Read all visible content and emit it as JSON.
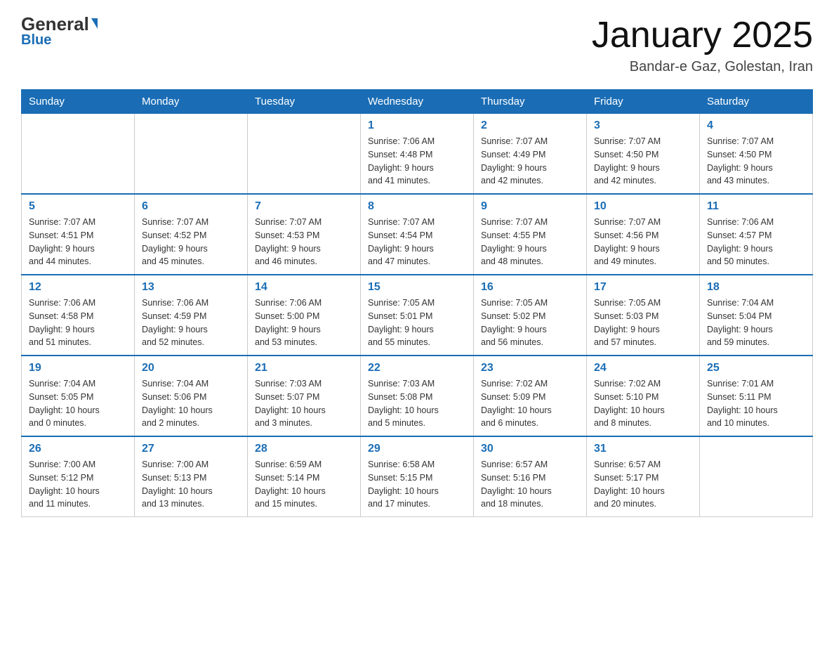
{
  "header": {
    "logo_top": "General",
    "logo_bottom": "Blue",
    "title": "January 2025",
    "subtitle": "Bandar-e Gaz, Golestan, Iran"
  },
  "days_of_week": [
    "Sunday",
    "Monday",
    "Tuesday",
    "Wednesday",
    "Thursday",
    "Friday",
    "Saturday"
  ],
  "weeks": [
    [
      {
        "day": "",
        "info": ""
      },
      {
        "day": "",
        "info": ""
      },
      {
        "day": "",
        "info": ""
      },
      {
        "day": "1",
        "info": "Sunrise: 7:06 AM\nSunset: 4:48 PM\nDaylight: 9 hours\nand 41 minutes."
      },
      {
        "day": "2",
        "info": "Sunrise: 7:07 AM\nSunset: 4:49 PM\nDaylight: 9 hours\nand 42 minutes."
      },
      {
        "day": "3",
        "info": "Sunrise: 7:07 AM\nSunset: 4:50 PM\nDaylight: 9 hours\nand 42 minutes."
      },
      {
        "day": "4",
        "info": "Sunrise: 7:07 AM\nSunset: 4:50 PM\nDaylight: 9 hours\nand 43 minutes."
      }
    ],
    [
      {
        "day": "5",
        "info": "Sunrise: 7:07 AM\nSunset: 4:51 PM\nDaylight: 9 hours\nand 44 minutes."
      },
      {
        "day": "6",
        "info": "Sunrise: 7:07 AM\nSunset: 4:52 PM\nDaylight: 9 hours\nand 45 minutes."
      },
      {
        "day": "7",
        "info": "Sunrise: 7:07 AM\nSunset: 4:53 PM\nDaylight: 9 hours\nand 46 minutes."
      },
      {
        "day": "8",
        "info": "Sunrise: 7:07 AM\nSunset: 4:54 PM\nDaylight: 9 hours\nand 47 minutes."
      },
      {
        "day": "9",
        "info": "Sunrise: 7:07 AM\nSunset: 4:55 PM\nDaylight: 9 hours\nand 48 minutes."
      },
      {
        "day": "10",
        "info": "Sunrise: 7:07 AM\nSunset: 4:56 PM\nDaylight: 9 hours\nand 49 minutes."
      },
      {
        "day": "11",
        "info": "Sunrise: 7:06 AM\nSunset: 4:57 PM\nDaylight: 9 hours\nand 50 minutes."
      }
    ],
    [
      {
        "day": "12",
        "info": "Sunrise: 7:06 AM\nSunset: 4:58 PM\nDaylight: 9 hours\nand 51 minutes."
      },
      {
        "day": "13",
        "info": "Sunrise: 7:06 AM\nSunset: 4:59 PM\nDaylight: 9 hours\nand 52 minutes."
      },
      {
        "day": "14",
        "info": "Sunrise: 7:06 AM\nSunset: 5:00 PM\nDaylight: 9 hours\nand 53 minutes."
      },
      {
        "day": "15",
        "info": "Sunrise: 7:05 AM\nSunset: 5:01 PM\nDaylight: 9 hours\nand 55 minutes."
      },
      {
        "day": "16",
        "info": "Sunrise: 7:05 AM\nSunset: 5:02 PM\nDaylight: 9 hours\nand 56 minutes."
      },
      {
        "day": "17",
        "info": "Sunrise: 7:05 AM\nSunset: 5:03 PM\nDaylight: 9 hours\nand 57 minutes."
      },
      {
        "day": "18",
        "info": "Sunrise: 7:04 AM\nSunset: 5:04 PM\nDaylight: 9 hours\nand 59 minutes."
      }
    ],
    [
      {
        "day": "19",
        "info": "Sunrise: 7:04 AM\nSunset: 5:05 PM\nDaylight: 10 hours\nand 0 minutes."
      },
      {
        "day": "20",
        "info": "Sunrise: 7:04 AM\nSunset: 5:06 PM\nDaylight: 10 hours\nand 2 minutes."
      },
      {
        "day": "21",
        "info": "Sunrise: 7:03 AM\nSunset: 5:07 PM\nDaylight: 10 hours\nand 3 minutes."
      },
      {
        "day": "22",
        "info": "Sunrise: 7:03 AM\nSunset: 5:08 PM\nDaylight: 10 hours\nand 5 minutes."
      },
      {
        "day": "23",
        "info": "Sunrise: 7:02 AM\nSunset: 5:09 PM\nDaylight: 10 hours\nand 6 minutes."
      },
      {
        "day": "24",
        "info": "Sunrise: 7:02 AM\nSunset: 5:10 PM\nDaylight: 10 hours\nand 8 minutes."
      },
      {
        "day": "25",
        "info": "Sunrise: 7:01 AM\nSunset: 5:11 PM\nDaylight: 10 hours\nand 10 minutes."
      }
    ],
    [
      {
        "day": "26",
        "info": "Sunrise: 7:00 AM\nSunset: 5:12 PM\nDaylight: 10 hours\nand 11 minutes."
      },
      {
        "day": "27",
        "info": "Sunrise: 7:00 AM\nSunset: 5:13 PM\nDaylight: 10 hours\nand 13 minutes."
      },
      {
        "day": "28",
        "info": "Sunrise: 6:59 AM\nSunset: 5:14 PM\nDaylight: 10 hours\nand 15 minutes."
      },
      {
        "day": "29",
        "info": "Sunrise: 6:58 AM\nSunset: 5:15 PM\nDaylight: 10 hours\nand 17 minutes."
      },
      {
        "day": "30",
        "info": "Sunrise: 6:57 AM\nSunset: 5:16 PM\nDaylight: 10 hours\nand 18 minutes."
      },
      {
        "day": "31",
        "info": "Sunrise: 6:57 AM\nSunset: 5:17 PM\nDaylight: 10 hours\nand 20 minutes."
      },
      {
        "day": "",
        "info": ""
      }
    ]
  ]
}
